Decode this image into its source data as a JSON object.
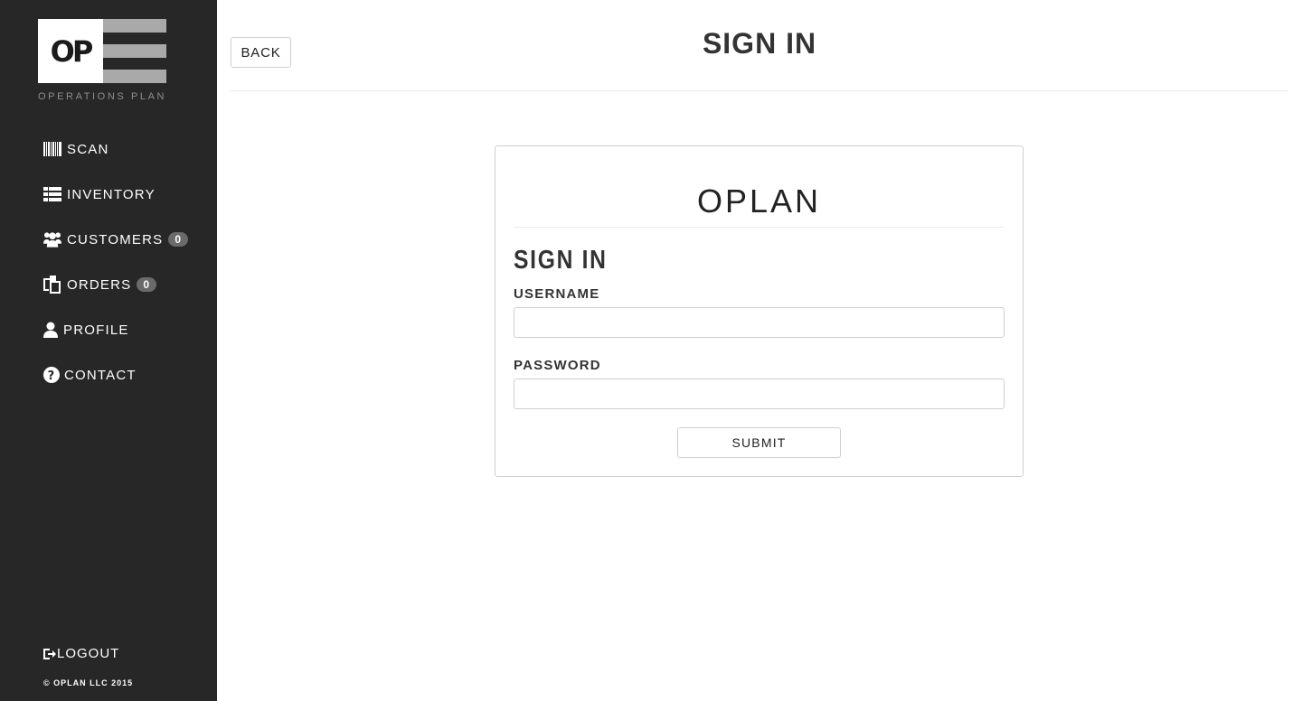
{
  "sidebar": {
    "logo_mark": "OP",
    "logo_subtitle": "OPERATIONS PLAN",
    "items": [
      {
        "label": "SCAN",
        "icon": "barcode-icon"
      },
      {
        "label": "INVENTORY",
        "icon": "list-icon"
      },
      {
        "label": "CUSTOMERS",
        "icon": "users-icon",
        "badge": "0"
      },
      {
        "label": "ORDERS",
        "icon": "copy-icon",
        "badge": "0"
      },
      {
        "label": "PROFILE",
        "icon": "user-icon"
      },
      {
        "label": "CONTACT",
        "icon": "question-icon"
      }
    ],
    "logout_label": "LOGOUT",
    "copyright": "© OPLAN LLC 2015"
  },
  "header": {
    "back_label": "BACK",
    "title": "SIGN IN"
  },
  "signin_card": {
    "brand": "OPLAN",
    "title": "SIGN IN",
    "username_label": "USERNAME",
    "username_value": "",
    "password_label": "PASSWORD",
    "password_value": "",
    "submit_label": "SUBMIT"
  },
  "colors": {
    "sidebar_bg": "#272727",
    "badge_bg": "#6a6a6a",
    "border": "#cfcfcf"
  }
}
